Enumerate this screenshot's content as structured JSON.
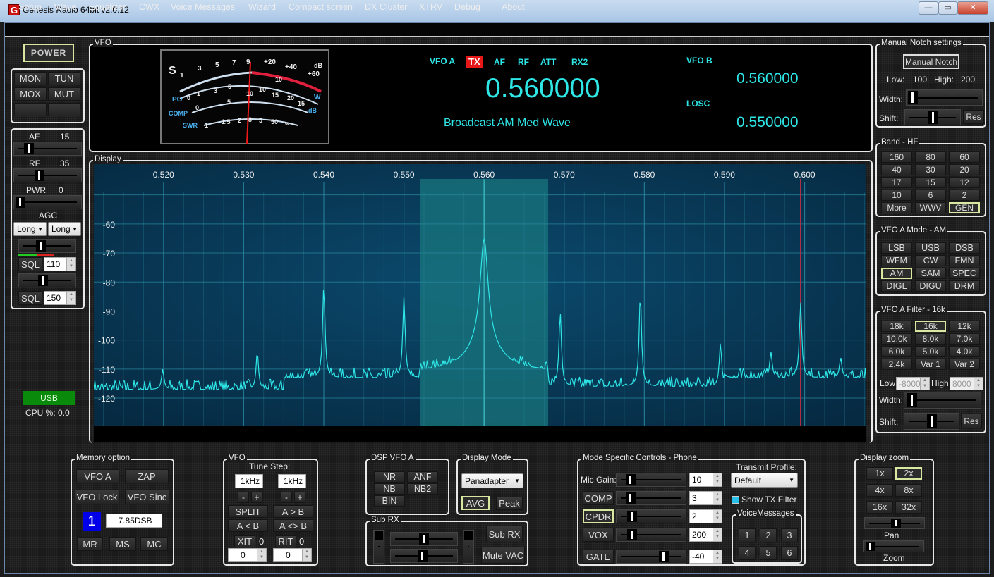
{
  "window": {
    "title": "Genesis Radio  64bit  v2.0.12",
    "logo": "G",
    "minimize": "—",
    "maximize": "▭",
    "close": "✕"
  },
  "menu": [
    "Setup",
    "Wave",
    "Equalizer",
    "CWX",
    "Voice Messages",
    "Wizard",
    "Compact screen",
    "DX Cluster",
    "XTRV",
    "Debug",
    "About"
  ],
  "left": {
    "power": "POWER",
    "buttons": [
      "MON",
      "TUN",
      "MOX",
      "MUT",
      "",
      ""
    ],
    "af": {
      "label": "AF",
      "value": "15",
      "level": 0.15
    },
    "rf": {
      "label": "RF",
      "value": "35",
      "level": 0.35
    },
    "pwr": {
      "label": "PWR",
      "value": "0",
      "level": 0
    },
    "agc": {
      "label": "AGC",
      "sel1": "Long",
      "sel2": "Long",
      "level": 0.35
    },
    "sql1": {
      "label": "SQL",
      "value": "110",
      "level": 0.35
    },
    "sql2": {
      "label": "SQL",
      "value": "150",
      "level": 0.4
    },
    "mode_badge": "USB",
    "cpu": "CPU %: 0.0"
  },
  "vfo": {
    "group": "VFO",
    "vfo_a_label": "VFO A",
    "tx": "TX",
    "af": "AF",
    "rf": "RF",
    "att": "ATT",
    "rx2": "RX2",
    "freq_a": "0.560000",
    "band_name": "Broadcast AM Med Wave",
    "vfo_b_label": "VFO B",
    "freq_b": "0.560000",
    "losc_label": "LOSC",
    "losc": "0.550000",
    "meter": {
      "s": "S",
      "s_ticks": [
        "1",
        "3",
        "5",
        "7",
        "9",
        "+20",
        "+40",
        "+60"
      ],
      "db": "dB",
      "po": "PO",
      "po_ticks": [
        "0",
        "1",
        "3",
        "5",
        "10",
        "15",
        "20"
      ],
      "w": "W",
      "comp": "COMP",
      "comp_ticks": [
        "0",
        "5",
        "10",
        "15"
      ],
      "swr": "SWR",
      "swr_ticks": [
        "1",
        "1.5",
        "2",
        "3",
        "5",
        "50",
        "∞"
      ],
      "comp_db": "dB",
      "po_top": [
        "10"
      ]
    }
  },
  "display": {
    "group": "Display"
  },
  "chart_data": {
    "type": "line",
    "x_ticks": [
      "0.520",
      "0.530",
      "0.540",
      "0.550",
      "0.560",
      "0.570",
      "0.580",
      "0.590",
      "0.600"
    ],
    "y_ticks": [
      "-60",
      "-70",
      "-80",
      "-90",
      "-100",
      "-110",
      "-120"
    ],
    "xlim": [
      0.5113,
      0.6077
    ],
    "ylim": [
      -129.7,
      -39.4
    ],
    "grid": true,
    "passband": [
      0.552,
      0.568
    ],
    "center_freq": 0.56,
    "marker_freq": 0.5995,
    "peaks": [
      {
        "f": 0.5199,
        "db": -110
      },
      {
        "f": 0.5317,
        "db": -104
      },
      {
        "f": 0.54,
        "db": -81
      },
      {
        "f": 0.55,
        "db": -85
      },
      {
        "f": 0.56,
        "db": -65
      },
      {
        "f": 0.5695,
        "db": -90
      },
      {
        "f": 0.5795,
        "db": -84
      },
      {
        "f": 0.5895,
        "db": -101
      },
      {
        "f": 0.5958,
        "db": -104
      },
      {
        "f": 0.5995,
        "db": -87
      },
      {
        "f": 0.6045,
        "db": -106
      }
    ],
    "noise_floor": [
      {
        "from": 0.5113,
        "to": 0.535,
        "db": -117
      },
      {
        "from": 0.535,
        "to": 0.552,
        "db": -113
      },
      {
        "from": 0.552,
        "to": 0.568,
        "db": -107
      },
      {
        "from": 0.568,
        "to": 0.59,
        "db": -116
      },
      {
        "from": 0.59,
        "to": 0.6077,
        "db": -113
      }
    ],
    "colors": {
      "trace": "#2ee6e6",
      "background": "#0a3a58",
      "passband": "#1a7a80",
      "marker": "#c0304a"
    }
  },
  "notch": {
    "group": "Manual Notch settings",
    "button": "Manual Notch",
    "low_label": "Low:",
    "low": "100",
    "high_label": "High:",
    "high": "200",
    "width": "Width:",
    "shift": "Shift:",
    "res": "Res"
  },
  "band": {
    "group": "Band - HF",
    "buttons": [
      "160",
      "80",
      "60",
      "40",
      "30",
      "20",
      "17",
      "15",
      "12",
      "10",
      "6",
      "2",
      "More",
      "WWV",
      "GEN"
    ],
    "selected": "GEN"
  },
  "mode": {
    "group": "VFO A Mode - AM",
    "buttons": [
      "LSB",
      "USB",
      "DSB",
      "WFM",
      "CW",
      "FMN",
      "AM",
      "SAM",
      "SPEC",
      "DIGL",
      "DIGU",
      "DRM"
    ],
    "selected": "AM"
  },
  "filter": {
    "group": "VFO A Filter - 16k",
    "buttons": [
      "18k",
      "16k",
      "12k",
      "10.0k",
      "8.0k",
      "7.0k",
      "6.0k",
      "5.0k",
      "4.0k",
      "2.4k",
      "Var 1",
      "Var 2"
    ],
    "selected": "16k",
    "low_label": "Low",
    "low": "-8000",
    "high_label": "High",
    "high": "8000",
    "width": "Width:",
    "shift": "Shift:",
    "res": "Res"
  },
  "memory": {
    "group": "Memory option",
    "vfo_a": "VFO A",
    "zap": "ZAP",
    "vfo_lock": "VFO Lock",
    "vfo_sinc": "VFO Sinc",
    "channel": "1",
    "entry": "7.85DSB",
    "mr": "MR",
    "ms": "MS",
    "mc": "MC"
  },
  "vfo_ctl": {
    "group": "VFO",
    "tune_step": "Tune Step:",
    "step1": "1kHz",
    "step2": "1kHz",
    "minus": "-",
    "plus": "+",
    "split": "SPLIT",
    "a_to_b": "A > B",
    "b_to_a": "A < B",
    "swap": "A <> B",
    "xit": "XIT",
    "xit_val": "0",
    "rit": "RIT",
    "rit_val": "0",
    "xit_input": "0",
    "rit_input": "0"
  },
  "dsp": {
    "group": "DSP VFO A",
    "buttons": [
      "NR",
      "ANF",
      "NB",
      "NB2",
      "BIN"
    ]
  },
  "display_mode": {
    "group": "Display Mode",
    "select": "Panadapter",
    "avg": "AVG",
    "peak": "Peak"
  },
  "subrx": {
    "group": "Sub RX",
    "button": "Sub RX",
    "mute": "Mute VAC"
  },
  "msc": {
    "group": "Mode Specific Controls - Phone",
    "mic": {
      "label": "Mic Gain:",
      "value": "10"
    },
    "comp": {
      "label": "COMP",
      "value": "3"
    },
    "cpdr": {
      "label": "CPDR",
      "value": "2"
    },
    "vox": {
      "label": "VOX",
      "value": "200"
    },
    "gate": {
      "label": "GATE",
      "value": "-40"
    },
    "tx_profile_label": "Transmit Profile:",
    "tx_profile": "Default",
    "show_tx_filter": "Show TX Filter",
    "vm_group": "VoiceMessages",
    "vm": [
      "1",
      "2",
      "3",
      "4",
      "5",
      "6"
    ]
  },
  "zoom": {
    "group": "Display zoom",
    "buttons": [
      "1x",
      "2x",
      "4x",
      "8x",
      "16x",
      "32x"
    ],
    "selected": "2x",
    "pan": "Pan",
    "zoom": "Zoom"
  }
}
